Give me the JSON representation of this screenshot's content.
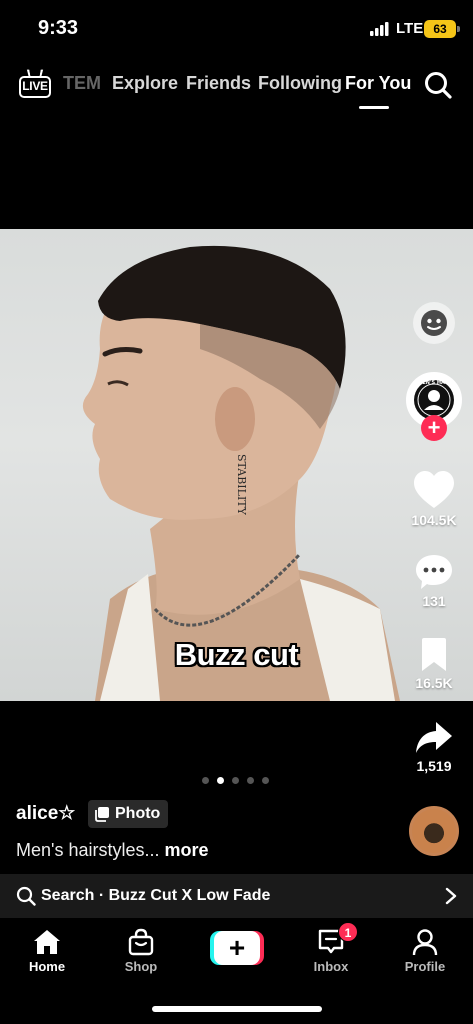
{
  "status_bar": {
    "time": "9:33",
    "network": "LTE",
    "battery": "63"
  },
  "top_nav": {
    "live_label": "LIVE",
    "tabs": [
      "TEM",
      "Explore",
      "Friends",
      "Following",
      "For You"
    ],
    "active_tab": "For You"
  },
  "post": {
    "caption_sticker": "Buzz cut",
    "neck_tattoo": "STABILITY",
    "carousel": {
      "total": 5,
      "current": 2
    },
    "author": "alice☆",
    "type_badge": "Photo",
    "description": "Men's hairstyles...",
    "more_label": "more"
  },
  "rail": {
    "likes": "104.5K",
    "comments": "131",
    "saves": "16.5K",
    "shares": "1,519",
    "creator_badge_text": "MEN'S HAIR"
  },
  "search_bar": {
    "text": "Search · Buzz Cut X Low Fade"
  },
  "bottom_nav": {
    "items": [
      "Home",
      "Shop",
      "Inbox",
      "Profile"
    ],
    "inbox_badge": "1",
    "active": "Home"
  },
  "colors": {
    "accent": "#fe2c55",
    "cyan": "#25f4ee",
    "background": "#000000"
  }
}
